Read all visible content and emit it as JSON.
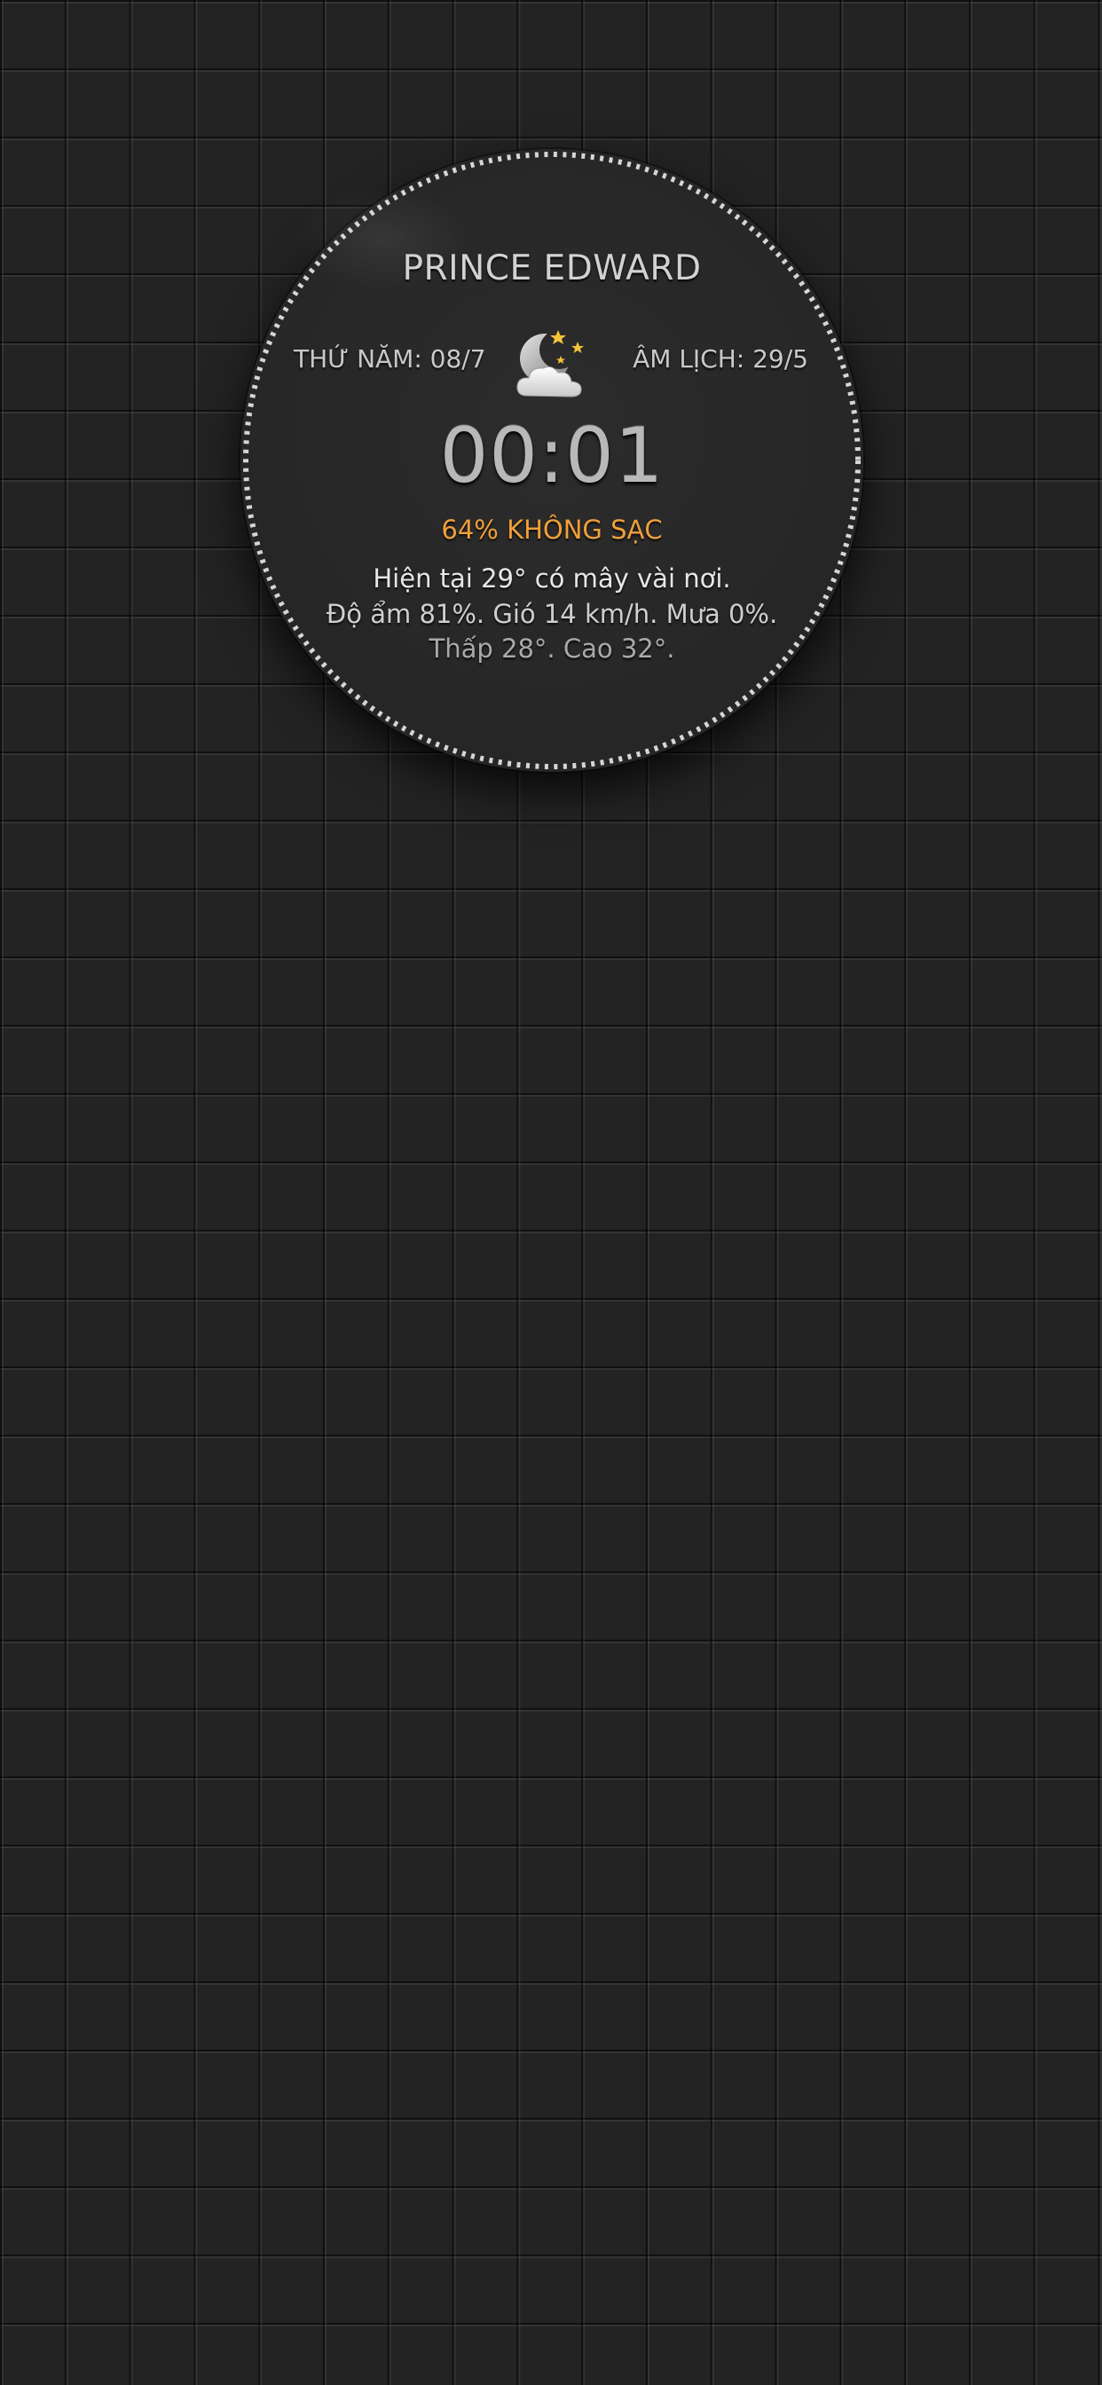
{
  "widget": {
    "city": "PRINCE EDWARD",
    "weekday_date": "THỨ NĂM: 08/7",
    "lunar_date": "ÂM LỊCH: 29/5",
    "weather_icon": "moon-cloud-stars-icon",
    "time": "00:01",
    "battery_status": "64% KHÔNG SẠC",
    "weather_current": "Hiện tại 29° có mây vài nơi.",
    "weather_details": "Độ ẩm 81%. Gió 14 km/h. Mưa 0%.",
    "weather_range": "Thấp 28°. Cao 32°."
  },
  "colors": {
    "background": "#232323",
    "accent_battery": "#f0a03a",
    "ring": "#d6d6d6"
  }
}
